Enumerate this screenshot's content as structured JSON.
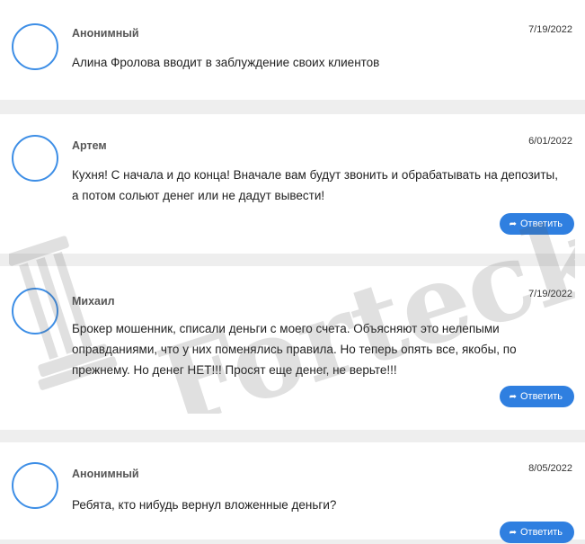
{
  "comments": [
    {
      "author": "Анонимный",
      "date": "7/19/2022",
      "text": "Алина Фролова вводит в заблуждение своих клиентов",
      "reply_label": ""
    },
    {
      "author": "Артем",
      "date": "6/01/2022",
      "text": "Кухня! С начала и до конца! Вначале вам будут звонить и обрабатывать на депозиты, а потом сольют денег или не дадут вывести!",
      "reply_label": "Ответить"
    },
    {
      "author": "Михаил",
      "date": "7/19/2022",
      "text": "Брокер мошенник, списали деньги с моего счета. Объясняют это нелепыми оправданиями, что у них поменялись правила. Но теперь опять все, якобы, по прежнему. Но денег НЕТ!!! Просят еще денег, не верьте!!!",
      "reply_label": "Ответить"
    },
    {
      "author": "Анонимный",
      "date": "8/05/2022",
      "text": "Ребята, кто нибудь вернул вложенные деньги?",
      "reply_label": "Ответить"
    }
  ],
  "icons": {
    "reply": "reply-arrow-icon",
    "avatar": "avatar-circle"
  },
  "colors": {
    "accent": "#2f7fe0",
    "avatar_border": "#3d8ee6",
    "page_bg": "#eeeeee"
  },
  "watermark": {
    "text": "Forteck"
  }
}
